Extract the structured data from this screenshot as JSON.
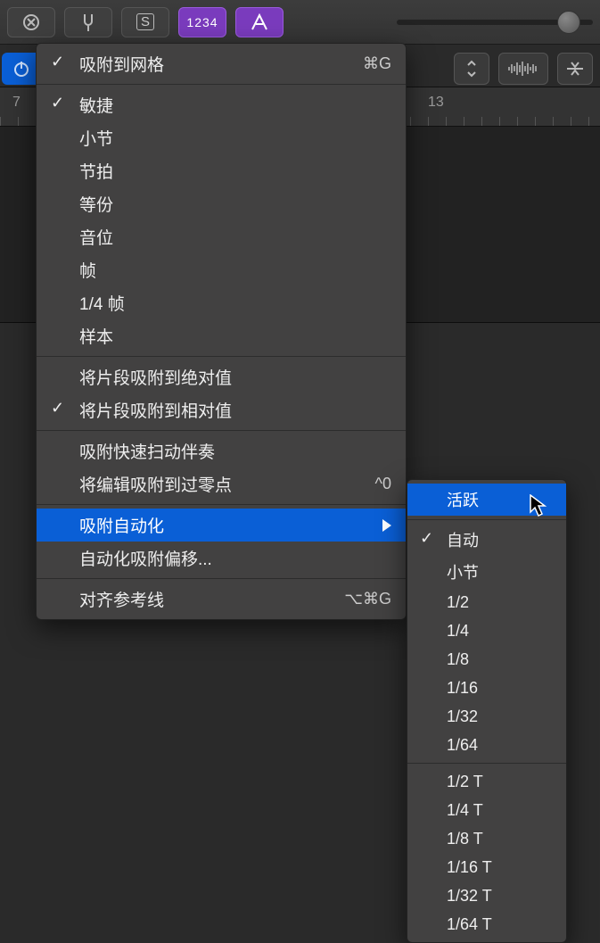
{
  "toolbar": {
    "close_icon": "close-icon",
    "fork_icon": "tuning-fork-icon",
    "s_label": "S",
    "num_label": "1234",
    "auto_icon": "automation-icon"
  },
  "ruler": {
    "mark_a": "7",
    "mark_b": "13"
  },
  "menu": {
    "snap_to_grid": "吸附到网格",
    "snap_to_grid_sc": "⌘G",
    "smart": "敏捷",
    "bar": "小节",
    "beat": "节拍",
    "division": "等份",
    "ticks": "音位",
    "frames": "帧",
    "quarter_frames": "1/4 帧",
    "samples": "样本",
    "snap_abs": "将片段吸附到绝对值",
    "snap_rel": "将片段吸附到相对值",
    "snap_scrub": "吸附快速扫动伴奏",
    "snap_zero": "将编辑吸附到过零点",
    "snap_zero_sc": "^0",
    "snap_auto": "吸附自动化",
    "auto_offset": "自动化吸附偏移...",
    "guides": "对齐参考线",
    "guides_sc": "⌥⌘G"
  },
  "submenu": {
    "active": "活跃",
    "auto": "自动",
    "bar": "小节",
    "d1_2": "1/2",
    "d1_4": "1/4",
    "d1_8": "1/8",
    "d1_16": "1/16",
    "d1_32": "1/32",
    "d1_64": "1/64",
    "t1_2": "1/2 T",
    "t1_4": "1/4 T",
    "t1_8": "1/8 T",
    "t1_16": "1/16 T",
    "t1_32": "1/32 T",
    "t1_64": "1/64 T"
  }
}
